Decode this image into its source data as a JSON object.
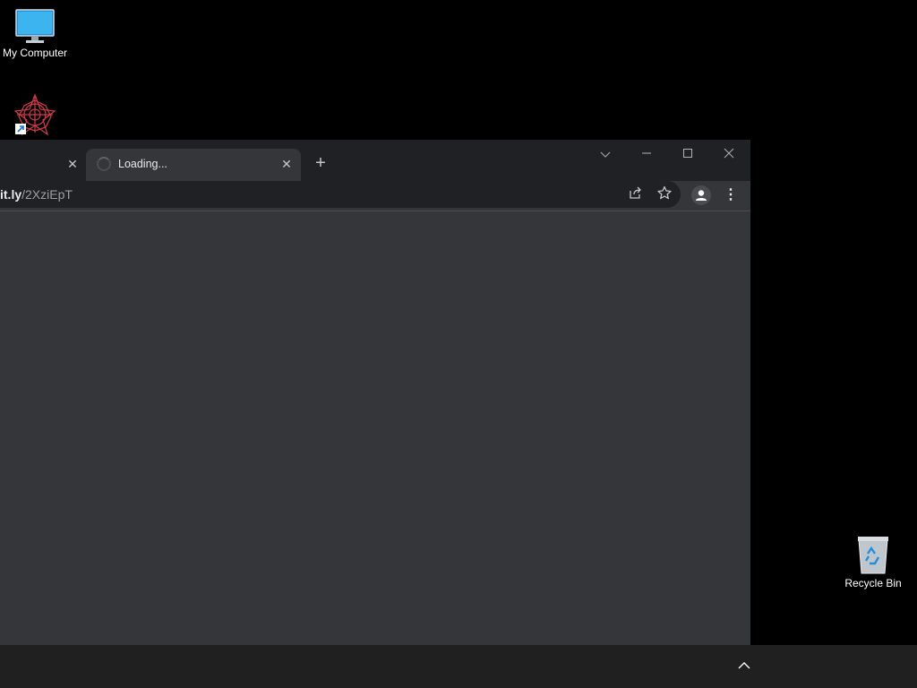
{
  "desktop": {
    "icons": [
      {
        "label": "My Computer",
        "icon": "monitor-icon"
      },
      {
        "label": "",
        "icon": "spiral-app-shortcut-icon"
      },
      {
        "label": "Recycle Bin",
        "icon": "recycle-bin-icon"
      }
    ]
  },
  "browser": {
    "tabs": [
      {
        "title": "",
        "close": "✕"
      },
      {
        "title": "Loading...",
        "close": "✕",
        "active": true
      }
    ],
    "new_tab": "+",
    "window_controls": {
      "tab_search": "⌵",
      "minimize": "—",
      "maximize": "☐",
      "close": "✕"
    },
    "address": {
      "host": "it.ly",
      "path": "/2XziEpT"
    },
    "toolbar": {
      "share_icon": "share-icon",
      "star_icon": "bookmark-star-icon",
      "profile_icon": "profile-icon",
      "menu": "⋮"
    }
  },
  "taskbar": {
    "tray_chevron": "^"
  },
  "colors": {
    "desktop_bg": "#000000",
    "browser_frame": "#202124",
    "browser_content": "#35363a",
    "taskbar": "#202020"
  }
}
